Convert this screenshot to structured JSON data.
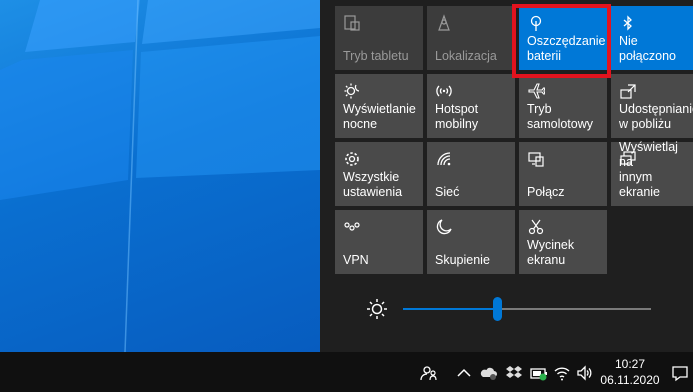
{
  "quick_actions": [
    {
      "id": "tablet",
      "label": "Tryb tabletu",
      "icon": "tablet-mode-icon",
      "state": "disabled"
    },
    {
      "id": "location",
      "label": "Lokalizacja",
      "icon": "location-icon",
      "state": "disabled"
    },
    {
      "id": "battery",
      "label": "Oszczędzanie\nbaterii",
      "icon": "battery-saver-icon",
      "state": "on"
    },
    {
      "id": "bluetooth",
      "label": "Nie połączono",
      "icon": "bluetooth-icon",
      "state": "on"
    },
    {
      "id": "night",
      "label": "Wyświetlanie\nnocne",
      "icon": "night-light-icon",
      "state": "off"
    },
    {
      "id": "hotspot",
      "label": "Hotspot\nmobilny",
      "icon": "hotspot-icon",
      "state": "off"
    },
    {
      "id": "airplane",
      "label": "Tryb\nsamolotowy",
      "icon": "airplane-icon",
      "state": "off"
    },
    {
      "id": "nearby",
      "label": "Udostępnianie\nw pobliżu",
      "icon": "nearby-share-icon",
      "state": "off"
    },
    {
      "id": "settings",
      "label": "Wszystkie\nustawienia",
      "icon": "gear-icon",
      "state": "off"
    },
    {
      "id": "network",
      "label": "Sieć",
      "icon": "network-icon",
      "state": "off"
    },
    {
      "id": "connect",
      "label": "Połącz",
      "icon": "connect-icon",
      "state": "off"
    },
    {
      "id": "project",
      "label": "Wyświetlaj na\ninnym ekranie",
      "icon": "project-icon",
      "state": "off"
    },
    {
      "id": "vpn",
      "label": "VPN",
      "icon": "vpn-icon",
      "state": "off"
    },
    {
      "id": "focus",
      "label": "Skupienie",
      "icon": "moon-icon",
      "state": "off"
    },
    {
      "id": "snip",
      "label": "Wycinek\nekranu",
      "icon": "snip-icon",
      "state": "off"
    }
  ],
  "brightness": {
    "level_percent": 38,
    "icon": "brightness-icon"
  },
  "taskbar": {
    "time": "10:27",
    "date": "06.11.2020",
    "tray_icons": [
      "people-icon",
      "chevron-up-icon",
      "onedrive-icon",
      "dropbox-icon",
      "battery-icon",
      "wifi-icon",
      "volume-icon",
      "notification-icon"
    ]
  },
  "colors": {
    "accent": "#0078d7",
    "highlight": "#e3131e",
    "tile": "#4a4a4a"
  }
}
